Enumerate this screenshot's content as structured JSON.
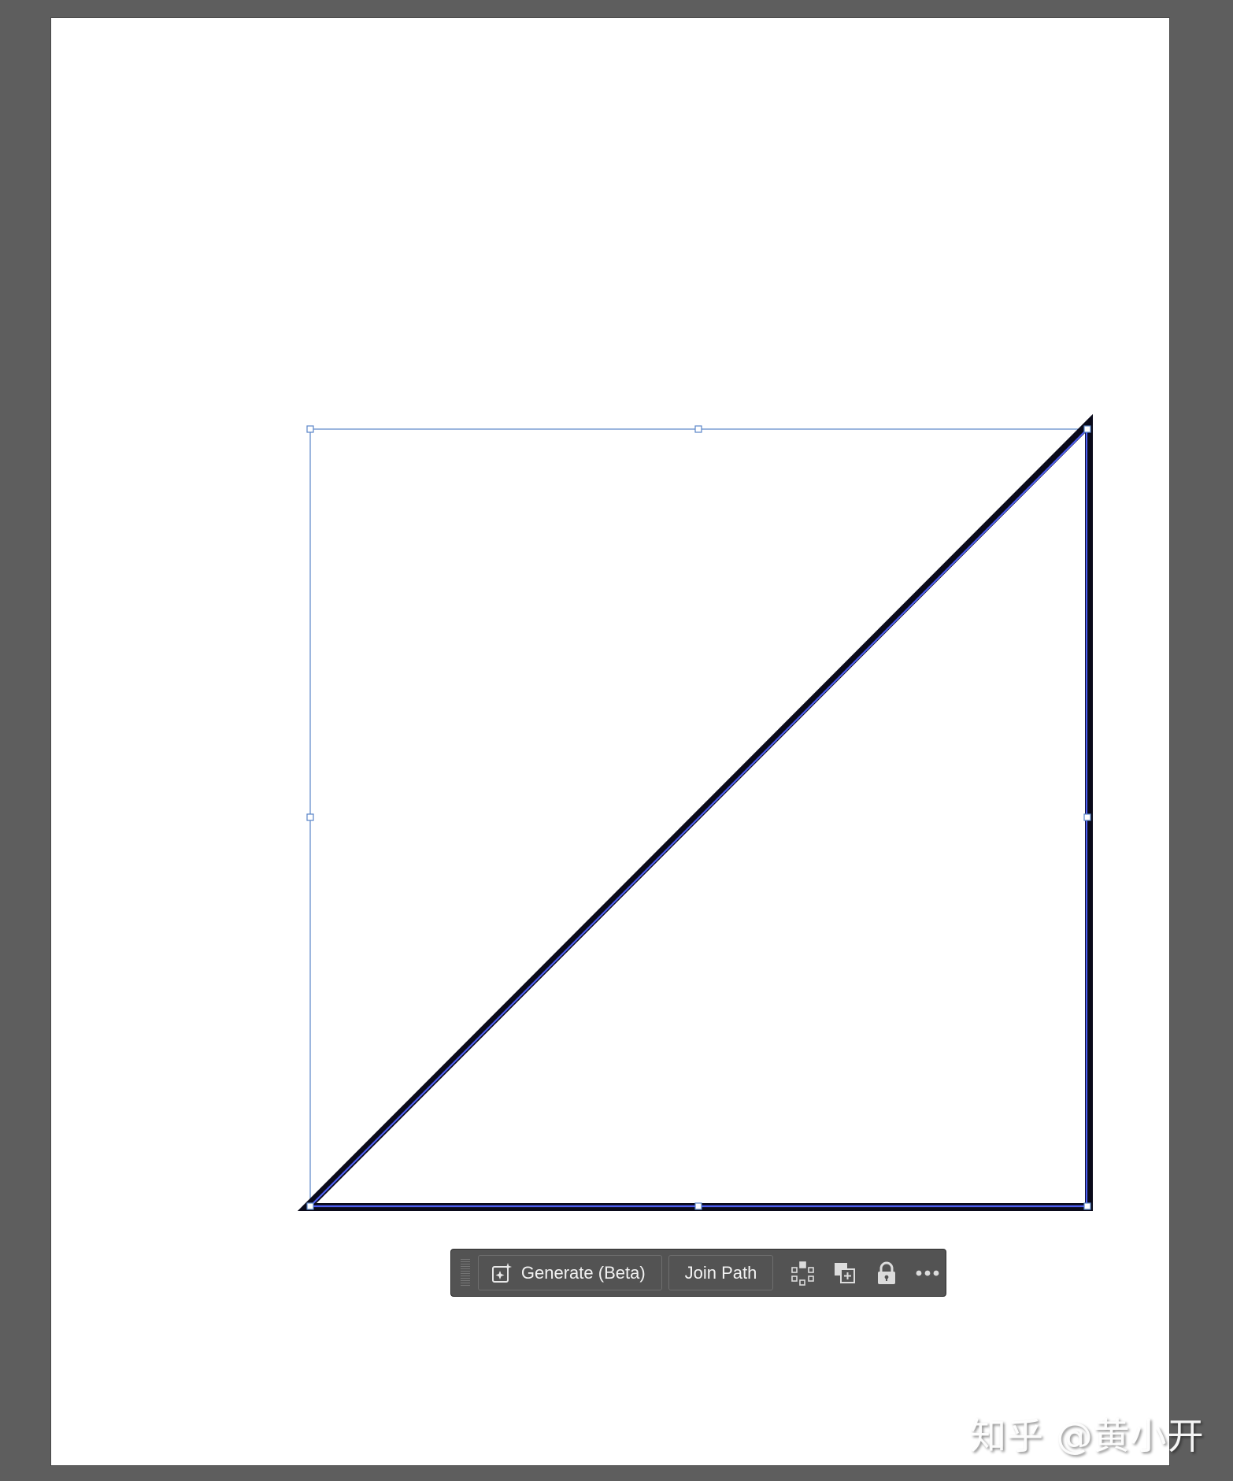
{
  "canvas": {
    "background_color": "#5e5e5e",
    "artboard_color": "#ffffff",
    "selection_color": "#5b86c8",
    "stroke_color": "#0a0a1a",
    "path_color": "#4d5ef0"
  },
  "shape": {
    "type": "right-triangle",
    "state": "selected"
  },
  "context_bar": {
    "generate_label": "Generate (Beta)",
    "join_path_label": "Join Path",
    "icons": {
      "generate": "generate-sparkle-icon",
      "isolate": "isolate-points-icon",
      "duplicate": "duplicate-icon",
      "lock": "lock-icon",
      "more": "more-options-icon"
    }
  },
  "watermark": {
    "text": "知乎 @黄小开"
  }
}
